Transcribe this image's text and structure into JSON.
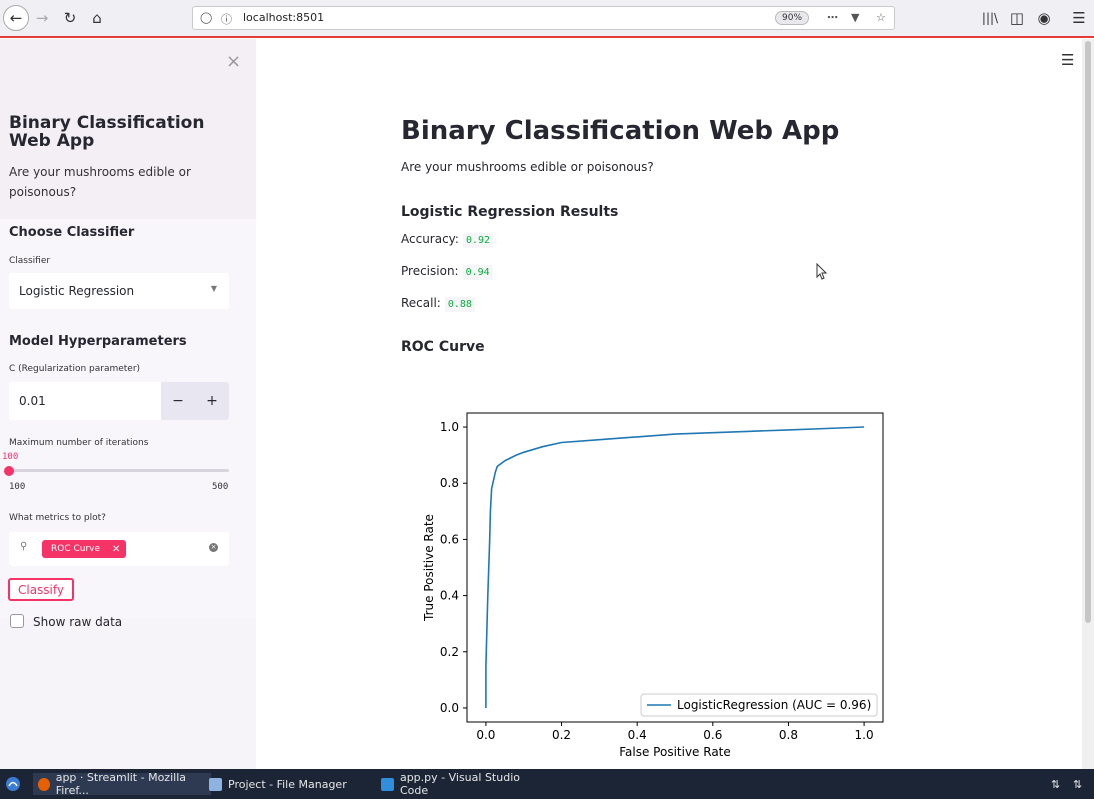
{
  "browser": {
    "url": "localhost:8501",
    "zoom": "90%"
  },
  "sidebar": {
    "title": "Binary Classification Web App",
    "subtitle": "Are your mushrooms edible or poisonous?",
    "choose_classifier_heading": "Choose Classifier",
    "classifier_label": "Classifier",
    "classifier_value": "Logistic Regression",
    "hyperparams_heading": "Model Hyperparameters",
    "c_label": "C (Regularization parameter)",
    "c_value": "0.01",
    "iter_label": "Maximum number of iterations",
    "iter_value": "100",
    "iter_min": "100",
    "iter_max": "500",
    "metrics_label": "What metrics to plot?",
    "metrics_selected": "ROC Curve",
    "classify_label": "Classify",
    "raw_data_label": "Show raw data"
  },
  "main": {
    "title": "Binary Classification Web App",
    "subtitle": "Are your mushrooms edible or poisonous?",
    "results_heading": "Logistic Regression Results",
    "accuracy_label": "Accuracy:",
    "accuracy_value": "0.92",
    "precision_label": "Precision:",
    "precision_value": "0.94",
    "recall_label": "Recall:",
    "recall_value": "0.88",
    "roc_heading": "ROC Curve"
  },
  "chart_data": {
    "type": "line",
    "xlabel": "False Positive Rate",
    "ylabel": "True Positive Rate",
    "xlim": [
      -0.05,
      1.05
    ],
    "ylim": [
      -0.05,
      1.05
    ],
    "xticks": [
      "0.0",
      "0.2",
      "0.4",
      "0.6",
      "0.8",
      "1.0"
    ],
    "yticks": [
      "0.0",
      "0.2",
      "0.4",
      "0.6",
      "0.8",
      "1.0"
    ],
    "grid": false,
    "legend_position": "lower-right",
    "color": "#1f77b4",
    "series": [
      {
        "name": "LogisticRegression (AUC = 0.96)",
        "x": [
          0.0,
          0.0,
          0.005,
          0.01,
          0.012,
          0.015,
          0.02,
          0.025,
          0.03,
          0.04,
          0.05,
          0.08,
          0.1,
          0.15,
          0.2,
          0.3,
          0.4,
          0.5,
          0.6,
          0.7,
          0.8,
          0.9,
          1.0
        ],
        "y": [
          0.0,
          0.15,
          0.4,
          0.6,
          0.7,
          0.78,
          0.81,
          0.84,
          0.86,
          0.87,
          0.88,
          0.9,
          0.91,
          0.93,
          0.945,
          0.955,
          0.965,
          0.975,
          0.98,
          0.985,
          0.99,
          0.995,
          1.0
        ]
      }
    ]
  },
  "taskbar": {
    "items": [
      "app · Streamlit - Mozilla Firef...",
      "Project - File Manager",
      "app.py - Visual Studio Code"
    ]
  }
}
